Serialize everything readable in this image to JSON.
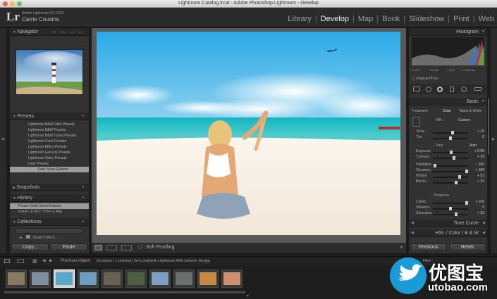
{
  "window": {
    "title": "Lightroom Catalog.lrcat - Adobe Photoshop Lightroom - Develop"
  },
  "app": {
    "logo": "Lr",
    "name": "Adobe Lightroom CC 2015",
    "user": "Carrie Cousins"
  },
  "modules": {
    "library": "Library",
    "develop": "Develop",
    "map": "Map",
    "book": "Book",
    "slideshow": "Slideshow",
    "print": "Print",
    "web": "Web",
    "separator": "|"
  },
  "navigator": {
    "title": "Navigator",
    "zoom": [
      "FIT",
      "FILL",
      "1:1",
      "1:1"
    ]
  },
  "presets": {
    "title": "Presets",
    "items": [
      "Lightroom B&W Filter Presets",
      "Lightroom B&W Presets",
      "Lightroom B&W Toned Presets",
      "Lightroom Color Presets",
      "Lightroom Effect Presets",
      "Lightroom General Presets",
      "Lightroom Video Presets",
      "User Presets"
    ],
    "selected": "Dark Snow Exterior"
  },
  "snapshots": {
    "title": "Snapshots"
  },
  "history": {
    "title": "History",
    "items": [
      "Preset: Dark Snow Exterior",
      "Import (1/28/17 9:54:16 AM)"
    ]
  },
  "collections": {
    "title": "Collections",
    "item": "Smart Collecti..."
  },
  "left_buttons": {
    "copy": "Copy...",
    "paste": "Paste"
  },
  "toolbar": {
    "soft_proofing": "Soft Proofing"
  },
  "histogram": {
    "title": "Histogram",
    "readout": [
      "0.0 EV",
      "16 mm",
      "f / 5.6",
      "1 / 200 sec"
    ],
    "original_photo": "Original Photo"
  },
  "basic": {
    "title": "Basic",
    "treatment": "Treatment :",
    "color": "Color",
    "bw": "Black & White",
    "wb_label": "WB :",
    "wb_value": "Custom",
    "tone_label": "Tone",
    "auto": "Auto",
    "presence_label": "Presence",
    "sliders": [
      {
        "label": "Temp",
        "value": "+ 10",
        "pos": 0.55
      },
      {
        "label": "Tint",
        "value": "0",
        "pos": 0.5
      },
      {
        "label": "Exposure",
        "value": "+ 0.05",
        "pos": 0.52
      },
      {
        "label": "Contrast",
        "value": "+ 29",
        "pos": 0.6
      },
      {
        "label": "Highlights",
        "value": "− 100",
        "pos": 0.05
      },
      {
        "label": "Shadows",
        "value": "+ 100",
        "pos": 0.95
      },
      {
        "label": "Whites",
        "value": "+ 52",
        "pos": 0.76
      },
      {
        "label": "Blacks",
        "value": "+ 33",
        "pos": 0.66
      },
      {
        "label": "Clarity",
        "value": "+ 100",
        "pos": 0.95
      },
      {
        "label": "Vibrance",
        "value": "0",
        "pos": 0.5
      },
      {
        "label": "Saturation",
        "value": "+ 33",
        "pos": 0.66
      }
    ]
  },
  "tone_curve": {
    "title": "Tone Curve"
  },
  "hsl": {
    "title": "HSL / Color / B & W"
  },
  "right_buttons": {
    "previous": "Previous",
    "reset": "Reset"
  },
  "filmstrip": {
    "source": "Previous Import",
    "info": "10 photos / 1 selected / Girl Looking At Lighthouse With Summer Sky.jpg",
    "filter": "Filter :",
    "thumbs": [
      {
        "color": "#8a7a60"
      },
      {
        "color": "#7d8fa0"
      },
      {
        "color": "#5aa8c8"
      },
      {
        "color": "#6c9ec0"
      },
      {
        "color": "#6a6050"
      },
      {
        "color": "#4f6040"
      },
      {
        "color": "#7e9ec6"
      },
      {
        "color": "#6a7070"
      },
      {
        "color": "#c88a40"
      },
      {
        "color": "#d09070"
      }
    ],
    "selected_index": 2
  },
  "watermark": {
    "brand": "优图宝",
    "domain": "utobao.com"
  },
  "colors": {
    "accent": "#f0f0f0",
    "panel": "#323232",
    "brand_blue": "#1a9ad6"
  }
}
